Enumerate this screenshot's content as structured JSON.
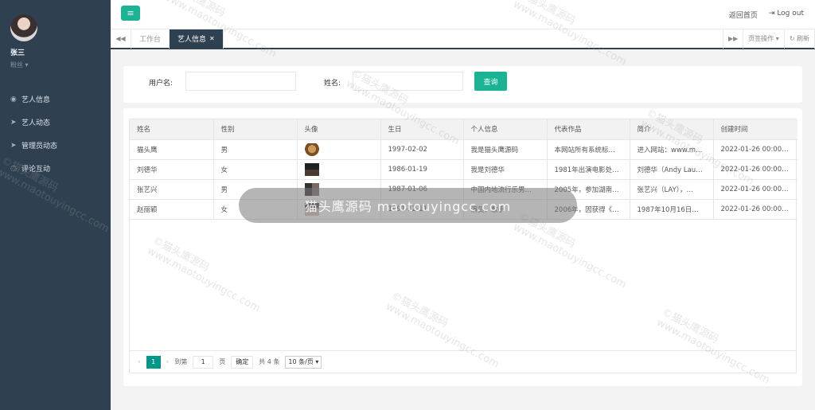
{
  "user": {
    "name": "张三",
    "role": "粉丝 ▾"
  },
  "sidebar": {
    "items": [
      {
        "label": "艺人信息",
        "icon": "person-icon",
        "glyph": "◉"
      },
      {
        "label": "艺人动态",
        "icon": "send-icon",
        "glyph": "➤"
      },
      {
        "label": "管理员动态",
        "icon": "send-icon",
        "glyph": "➤"
      },
      {
        "label": "评论互动",
        "icon": "comment-icon",
        "glyph": "◌"
      }
    ]
  },
  "topbar": {
    "menu_glyph": "≡",
    "home_label": "返回首页",
    "logout_label": "Log out",
    "logout_glyph": "⇥"
  },
  "tabs": {
    "left_arrow": "◀◀",
    "right_arrow": "▶▶",
    "items": [
      {
        "label": "工作台"
      },
      {
        "label": "艺人信息",
        "close": "✕"
      }
    ],
    "ops_label": "页签操作 ▾",
    "refresh_label": "↻ 刷新"
  },
  "search": {
    "username_label": "用户名:",
    "username_value": "",
    "name_label": "姓名:",
    "name_value": "",
    "button_label": "查询"
  },
  "table": {
    "columns": [
      "姓名",
      "性别",
      "头像",
      "生日",
      "个人信息",
      "代表作品",
      "简介",
      "创建时间"
    ],
    "rows": [
      {
        "name": "猫头鹰",
        "gender": "男",
        "birthday": "1997-02-02",
        "info": "我是猫头鹰源码",
        "works": "本网站所有系统标…",
        "intro": "进入网站：www.m…",
        "created": "2022-01-26 00:00:00"
      },
      {
        "name": "刘德华",
        "gender": "女",
        "birthday": "1986-01-19",
        "info": "我是刘德华",
        "works": "1981年出演电影处…",
        "intro": "刘德华（Andy Lau…",
        "created": "2022-01-26 00:00:00"
      },
      {
        "name": "张艺兴",
        "gender": "男",
        "birthday": "1987-01-06",
        "info": "中国内地流行乐男…",
        "works": "2005年，参加湖南…",
        "intro": "张艺兴（LAY），…",
        "created": "2022-01-26 00:00:00"
      },
      {
        "name": "赵丽颖",
        "gender": "女",
        "birthday": "1991-12-11",
        "info": "演员、歌手",
        "works": "2006年，因获得《…",
        "intro": "1987年10月16日…",
        "created": "2022-01-26 00:00:00"
      }
    ]
  },
  "pager": {
    "prev": "‹",
    "page": "1",
    "next": "›",
    "goto_label": "到第",
    "goto_value": "1",
    "page_unit": "页",
    "confirm_label": "确定",
    "total_label": "共 4 条",
    "size_label": "10 条/页 ▾"
  },
  "watermark": {
    "text_cn": "©猫头鹰源码",
    "text_url": "www.maotouyingcc.com",
    "toast": "猫头鹰源码 maotouyingcc.com"
  },
  "colors": {
    "sidebar": "#2f4050",
    "accent": "#1ab394",
    "pager_active": "#009688"
  }
}
